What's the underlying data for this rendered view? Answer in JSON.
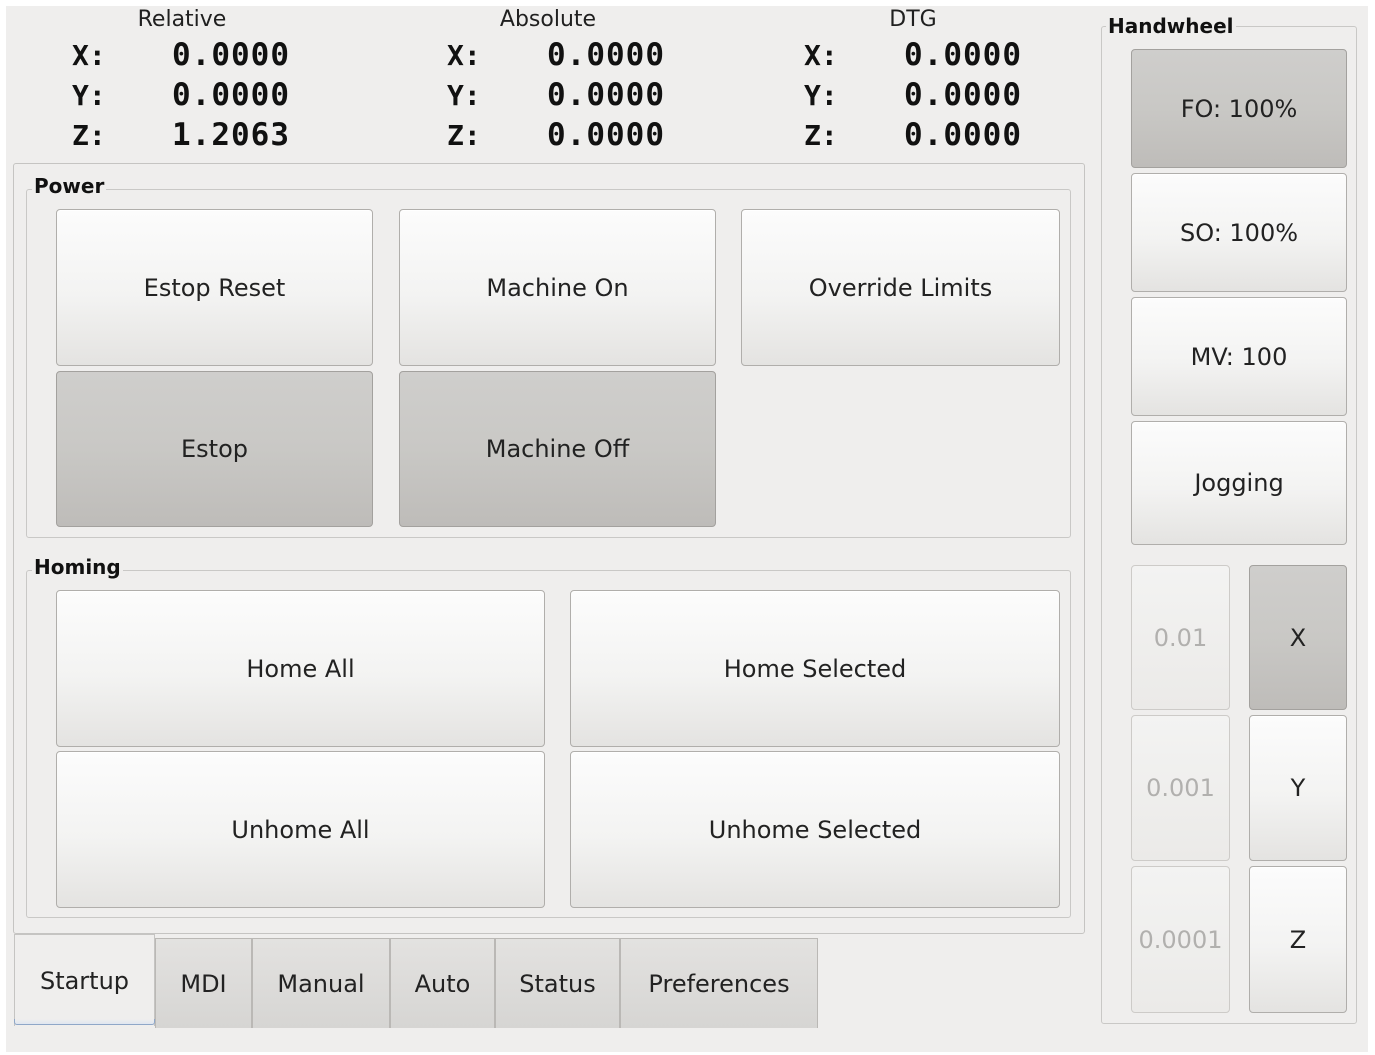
{
  "dro": {
    "relative": {
      "header": "Relative",
      "x": "0.0000",
      "y": "0.0000",
      "z": "1.2063"
    },
    "absolute": {
      "header": "Absolute",
      "x": "0.0000",
      "y": "0.0000",
      "z": "0.0000"
    },
    "dtg": {
      "header": "DTG",
      "x": "0.0000",
      "y": "0.0000",
      "z": "0.0000"
    },
    "axis_labels": {
      "x": "X:",
      "y": "Y:",
      "z": "Z:"
    }
  },
  "power": {
    "title": "Power",
    "estop_reset": "Estop Reset",
    "machine_on": "Machine On",
    "override_limits": "Override Limits",
    "estop": "Estop",
    "machine_off": "Machine Off"
  },
  "homing": {
    "title": "Homing",
    "home_all": "Home All",
    "home_selected": "Home Selected",
    "unhome_all": "Unhome All",
    "unhome_selected": "Unhome Selected"
  },
  "tabs": [
    "Startup",
    "MDI",
    "Manual",
    "Auto",
    "Status",
    "Preferences"
  ],
  "handwheel": {
    "title": "Handwheel",
    "fo": "FO: 100%",
    "so": "SO: 100%",
    "mv": "MV: 100",
    "jogging": "Jogging",
    "increments": [
      "0.01",
      "0.001",
      "0.0001"
    ],
    "axes": [
      "X",
      "Y",
      "Z"
    ]
  }
}
